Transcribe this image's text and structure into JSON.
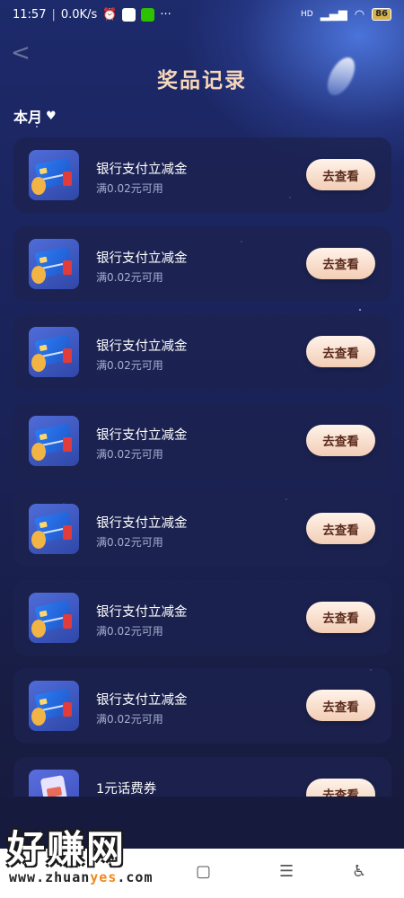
{
  "status_bar": {
    "time": "11:57",
    "speed": "0.0K/s",
    "battery": "86",
    "network": "HD"
  },
  "header": {
    "title": "奖品记录",
    "back_label": "<"
  },
  "filter": {
    "month_label": "本月",
    "heart": "♥"
  },
  "prizes": [
    {
      "name": "银行支付立减金",
      "condition": "满0.02元可用",
      "action": "去查看",
      "thumb": "bank-card"
    },
    {
      "name": "银行支付立减金",
      "condition": "满0.02元可用",
      "action": "去查看",
      "thumb": "bank-card"
    },
    {
      "name": "银行支付立减金",
      "condition": "满0.02元可用",
      "action": "去查看",
      "thumb": "bank-card"
    },
    {
      "name": "银行支付立减金",
      "condition": "满0.02元可用",
      "action": "去查看",
      "thumb": "bank-card"
    },
    {
      "name": "银行支付立减金",
      "condition": "满0.02元可用",
      "action": "去查看",
      "thumb": "bank-card"
    },
    {
      "name": "银行支付立减金",
      "condition": "满0.02元可用",
      "action": "去查看",
      "thumb": "bank-card"
    },
    {
      "name": "银行支付立减金",
      "condition": "满0.02元可用",
      "action": "去查看",
      "thumb": "bank-card"
    },
    {
      "name": "1元话费券",
      "condition": "",
      "action": "去查看",
      "thumb": "phone"
    }
  ],
  "watermark": {
    "big": "好赚网",
    "url_pre": "www.zhuan",
    "url_accent": "yes",
    "url_post": ".com"
  },
  "nav": {
    "home": "▢",
    "menu": "☰",
    "access": "♿"
  },
  "colors": {
    "title": "#f7d7b8",
    "button_text": "#5b2b1d",
    "background": "#1a2048"
  }
}
